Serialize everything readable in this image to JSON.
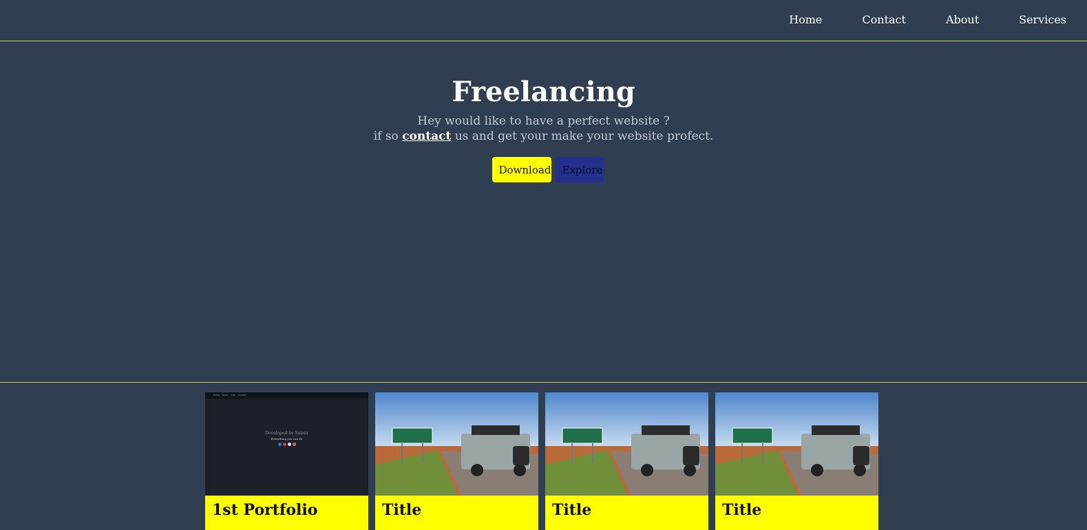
{
  "nav": {
    "links": [
      "Home",
      "Contact",
      "About",
      "Services"
    ]
  },
  "hero": {
    "title": "Freelancing",
    "line1": "Hey would like to have a perfect website ?",
    "line2_before": "if so",
    "line2_link": "contact",
    "line2_after": "us and get your make your website profect.",
    "download_label": "Download",
    "explore_label": "Explore"
  },
  "cards": [
    {
      "title": "1st Portfolio",
      "preview": {
        "nav_items": [
          "Home",
          "Social",
          "Info",
          "Contact"
        ],
        "line1": "Developed by Sabuu",
        "line2": "Everything you can do"
      }
    },
    {
      "title": "Title"
    },
    {
      "title": "Title"
    },
    {
      "title": "Title"
    }
  ],
  "colors": {
    "background": "#2f3e51",
    "accent_line": "#c9d64a",
    "download_bg": "#ffff00",
    "explore_bg": "#23318d",
    "card_bg": "#ffff00"
  }
}
